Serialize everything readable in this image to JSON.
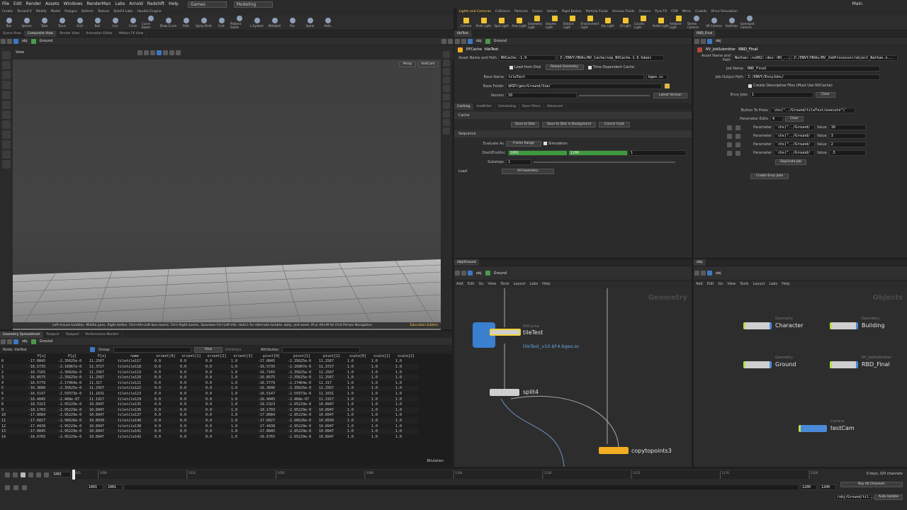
{
  "menubar": {
    "items": [
      "File",
      "Edit",
      "Render",
      "Assets",
      "Windows",
      "RenderMan",
      "Labs",
      "Arnold",
      "Redshift",
      "Help"
    ],
    "desktop": "Games",
    "context": "Modeling",
    "user": "Main"
  },
  "shelf_tabs_left": [
    "Create",
    "TerrainFX",
    "Modify",
    "Model",
    "Polygon",
    "Deform",
    "Texture",
    "SideFX Labs",
    "Houdini Engine"
  ],
  "shelf_tabs_right": [
    "Lights and Cameras",
    "Collisions",
    "Particles",
    "Grains",
    "Vellum",
    "Rigid Bodies",
    "Particle Fluids",
    "Viscous Fluids",
    "Oceans",
    "Pyro FX",
    "FEM",
    "Wires",
    "Crowds",
    "Drive Simulation"
  ],
  "tools_left": [
    "Box",
    "Sphere",
    "Tube",
    "Torus",
    "Grid",
    "Null",
    "Line",
    "Circle",
    "Curve Bezier",
    "Draw Curve",
    "Path",
    "Spray Paint",
    "Font",
    "Platonic Solids",
    "L-System",
    "Metaball",
    "File",
    "Spiral",
    "Helix"
  ],
  "tools_right": [
    "Camera",
    "Point Light",
    "Spot Light",
    "Area Light",
    "Geometry Light",
    "Volume Light",
    "Distant Light",
    "Environment Light",
    "Sky Light",
    "GI Light",
    "Caustic Light",
    "Portal Light",
    "Ambient Light",
    "Stereo Camera",
    "VR Camera",
    "Switcher",
    "Gamepad Camera"
  ],
  "viewer": {
    "tabs": [
      "Scene View",
      "Composite View",
      "Render View",
      "Animation Editor",
      "Motion FX View"
    ],
    "path": [
      "obj",
      "Ground"
    ],
    "view_label": "View",
    "persp": "Persp",
    "camera": "testCam",
    "hint": "Left mouse tumbles. Middle pans. Right dollies. Ctrl+Alt+Left box-zooms. Ctrl+Right zooms. Spacebar-Ctrl-Left tilts. Hold L for alternate tumble, dolly, and zoom.    M or Alt+M for First Person Navigation.",
    "edu": "Education Edition"
  },
  "rfcache": {
    "tab": "tileTest",
    "path": [
      "obj",
      "Ground"
    ],
    "type": "RFCache",
    "name": "tileTest",
    "asset_label": "Asset Name and Path",
    "asset_name": "NVCache::1.9",
    "asset_path": "Z:/ENVY/HDAs/NV_Cache/sop_NVCache.1.9.hdanc",
    "load_from_disk": "Load from Disk",
    "reload": "Reload Geometry",
    "time_dep": "Time Dependent Cache",
    "base_name_label": "Base Name",
    "base_name": "tileTest",
    "ext": "bgeo.sc",
    "base_folder_label": "Base Folder",
    "base_folder": "$HIP/geo/Ground/Sim/",
    "version_label": "Version",
    "version": "10",
    "latest": "Latest Version",
    "tabs": [
      "Caching",
      "lineWriter",
      "Scheduling",
      "Save Filters",
      "Advanced"
    ],
    "cache_section": "Cache",
    "save": "Save to Disk",
    "save_bg": "Save to Disk in Background",
    "cancel": "Cancel Cook",
    "sequence": "Sequence",
    "evaluate_label": "Evaluate As",
    "evaluate": "Frame Range",
    "simulation": "Simulation",
    "sei_label": "Start/End/Inc",
    "start": "1001",
    "end": "1200",
    "inc": "1",
    "substeps_label": "Substeps",
    "substeps": "1",
    "load_label": "Load",
    "load": "All Geometry"
  },
  "jobsub": {
    "tab": "RBD_Final",
    "path": [
      "obj"
    ],
    "type": "NV_JobSubmitter",
    "name": "RBD_Final",
    "asset_label": "Asset Name and Path",
    "asset_name": "Nathan::nv002::dev::NV_...",
    "asset_path": "Z:/ENVY/HDAs/NV_JobProcessor/object_Nathan.n...",
    "job_name_label": "Job Name",
    "job_name": "RBD_Final",
    "output_label": "Job Output Path",
    "output": "Z:/ENVY/EnvyJobs/",
    "create_desc": "Create Descriptive Files (Must Use NVCache)",
    "envy_jobs_label": "Envy Jobs",
    "envy_jobs": "1",
    "clear": "Clear",
    "button_label": "Button To Press",
    "button_value": "`chs(\"../Ground/tileTest/execute\")`",
    "param_edits_label": "Parameter Edits",
    "param_edits": "4",
    "params": [
      {
        "label": "Parameter",
        "expr": "`chs(\"../Ground/",
        "value_label": "Value",
        "value": "10"
      },
      {
        "label": "Parameter",
        "expr": "`chs(\"../Ground/",
        "value_label": "Value",
        "value": "3"
      },
      {
        "label": "Parameter",
        "expr": "`chs(\"../Ground/",
        "value_label": "Value",
        "value": "2"
      },
      {
        "label": "Parameter",
        "expr": "`chs(\"../Ground/",
        "value_label": "Value",
        "value": ".5"
      }
    ],
    "duplicate": "Duplicate Job",
    "create": "Create Envy Jobs"
  },
  "net_left": {
    "tab": "/obj/Ground",
    "path": [
      "obj",
      "Ground"
    ],
    "menu": [
      "Add",
      "Edit",
      "Go",
      "View",
      "Tools",
      "Layout",
      "Labs",
      "Help"
    ],
    "watermark": "Geometry",
    "nodes": {
      "cache_type": "NVCache",
      "cache": "tileTest",
      "cache_file": "tileTest_v10.$F4.bgeo.sc",
      "split": "split4",
      "copy": "copytopoints3"
    }
  },
  "net_right": {
    "tab": "/obj",
    "path": [
      "obj"
    ],
    "menu": [
      "Add",
      "Edit",
      "Go",
      "View",
      "Tools",
      "Layout",
      "Labs",
      "Help"
    ],
    "watermark": "Objects",
    "nodes": [
      {
        "type": "Geometry",
        "name": "Character"
      },
      {
        "type": "Geometry",
        "name": "Building"
      },
      {
        "type": "Geometry",
        "name": "Ground"
      },
      {
        "type": "NV_JobSubmitter",
        "name": "RBD_Final"
      },
      {
        "type": "Camera",
        "name": "testCam"
      }
    ]
  },
  "spreadsheet": {
    "tabs": [
      "Geometry Spreadsheet",
      "Textport",
      "Taskport",
      "Performance Monitor"
    ],
    "path": [
      "obj",
      "Ground"
    ],
    "node": "Node: tileTest",
    "group_label": "Group:",
    "view": "View",
    "intrinsics": "Intrinsics",
    "attributes": "Attributes:",
    "cols": [
      "",
      "P[x]",
      "P[y]",
      "P[z]",
      "name",
      "orient[0]",
      "orient[1]",
      "orient[2]",
      "orient[3]",
      "pivot[0]",
      "pivot[1]",
      "pivot[2]",
      "scale[0]",
      "scale[1]",
      "scale[2]"
    ],
    "rows": [
      [
        "0",
        "-17.0845",
        "-2.35625e-0",
        "11.2567",
        "tiletile117",
        "0.0",
        "0.0",
        "0.0",
        "1.0",
        "-17.0845",
        "-2.35625e-0",
        "11.2567",
        "1.0",
        "1.0",
        "1.0"
      ],
      [
        "1",
        "-16.5735",
        "-2.16967e-0",
        "11.3727",
        "tiletile118",
        "0.0",
        "0.0",
        "0.0",
        "1.0",
        "-16.5735",
        "-2.16967e-0",
        "11.3727",
        "1.0",
        "1.0",
        "1.0"
      ],
      [
        "2",
        "-16.7165",
        "-2.30926e-0",
        "11.2567",
        "tiletile119",
        "0.0",
        "0.0",
        "0.0",
        "1.0",
        "-16.7165",
        "-2.35625e-0",
        "11.2567",
        "1.0",
        "1.0",
        "1.0"
      ],
      [
        "3",
        "-16.8575",
        "-2.35625e-0",
        "11.2567",
        "tiletile120",
        "0.0",
        "0.0",
        "0.0",
        "1.0",
        "-16.8575",
        "-2.35625e-0",
        "11.2567",
        "1.0",
        "1.0",
        "1.0"
      ],
      [
        "4",
        "-16.5779",
        "-2.17464e-0",
        "11.317",
        "tiletile121",
        "0.0",
        "0.0",
        "0.0",
        "1.0",
        "-16.5779",
        "-2.17464e-0",
        "11.317",
        "1.0",
        "1.0",
        "1.0"
      ],
      [
        "5",
        "-16.3606",
        "-2.35625e-0",
        "11.2567",
        "tiletile122",
        "0.0",
        "0.0",
        "0.0",
        "1.0",
        "-16.3606",
        "-2.35625e-0",
        "11.2567",
        "1.0",
        "1.0",
        "1.0"
      ],
      [
        "6",
        "-16.5147",
        "-2.59373e-0",
        "11.1631",
        "tiletile123",
        "0.0",
        "0.0",
        "0.0",
        "1.0",
        "-16.5147",
        "-2.59373e-0",
        "11.1631",
        "1.0",
        "1.0",
        "1.0"
      ],
      [
        "7",
        "-16.4045",
        "-2.468e-07",
        "11.1917",
        "tiletile129",
        "0.0",
        "0.0",
        "0.0",
        "1.0",
        "-16.4045",
        "-2.468e-07",
        "11.1917",
        "1.0",
        "1.0",
        "1.0"
      ],
      [
        "8",
        "-18.5323",
        "-2.95229e-0",
        "10.8947",
        "tiletile135",
        "0.0",
        "0.0",
        "0.0",
        "1.0",
        "-18.5323",
        "-2.95229e-0",
        "10.8947",
        "1.0",
        "1.0",
        "1.0"
      ],
      [
        "9",
        "-18.1703",
        "-2.95229e-0",
        "10.8947",
        "tiletile136",
        "0.0",
        "0.0",
        "0.0",
        "1.0",
        "-18.1703",
        "-2.95229e-0",
        "10.8947",
        "1.0",
        "1.0",
        "1.0"
      ],
      [
        "10",
        "-17.8084",
        "-2.95229e-0",
        "10.8947",
        "tiletile137",
        "0.0",
        "0.0",
        "0.0",
        "1.0",
        "-17.8084",
        "-2.95229e-0",
        "10.8947",
        "1.0",
        "1.0",
        "1.0"
      ],
      [
        "11",
        "-17.6027",
        "-2.96626e-0",
        "10.8939",
        "tiletile140",
        "0.0",
        "0.0",
        "0.0",
        "1.0",
        "-17.6027",
        "-2.96626e-0",
        "10.8939",
        "1.0",
        "1.0",
        "1.0"
      ],
      [
        "12",
        "-17.4438",
        "-2.95229e-0",
        "10.8947",
        "tiletile138",
        "0.0",
        "0.0",
        "0.0",
        "1.0",
        "-17.4438",
        "-2.95229e-0",
        "10.8947",
        "1.0",
        "1.0",
        "1.0"
      ],
      [
        "13",
        "-17.0845",
        "-2.95229e-0",
        "10.8947",
        "tiletile141",
        "0.0",
        "0.0",
        "0.0",
        "1.0",
        "-17.0845",
        "-2.95229e-0",
        "10.8947",
        "1.0",
        "1.0",
        "1.0"
      ],
      [
        "14",
        "-16.6765",
        "-2.95229e-0",
        "10.8947",
        "tiletile142",
        "0.0",
        "0.0",
        "0.0",
        "1.0",
        "-16.6765",
        "-2.95229e-0",
        "10.8947",
        "1.0",
        "1.0",
        "1.0"
      ]
    ],
    "footer": "Bilulation"
  },
  "timeline": {
    "frame": "1001",
    "ticks": [
      "1001",
      "1008",
      "1032",
      "1056",
      "1080",
      "1104",
      "1128",
      "1152",
      "1176",
      "1200"
    ],
    "start": "1001",
    "start2": "1001",
    "end": "1200",
    "end2": "1200",
    "keys": "0 keys, 0/0 channels",
    "keyall": "Key All Channels",
    "path": "/obj/Ground/til...",
    "update": "Auto Update"
  }
}
